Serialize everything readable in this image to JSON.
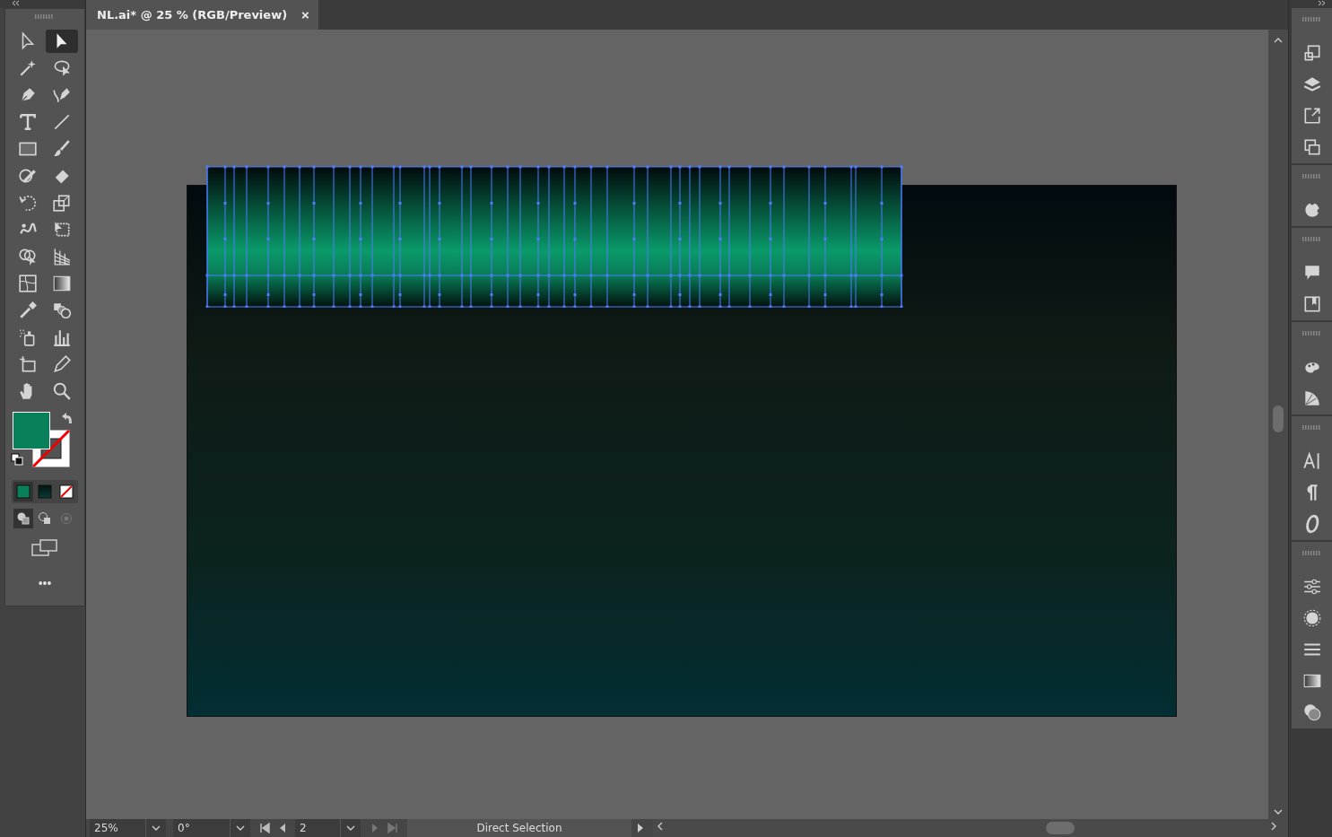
{
  "document_tab": {
    "title": "NL.ai* @ 25 % (RGB/Preview)",
    "close": "×"
  },
  "tools": [
    {
      "kind": "arrow",
      "selected": false
    },
    {
      "kind": "filled-arrow",
      "selected": true
    },
    {
      "kind": "magic-wand",
      "selected": false
    },
    {
      "kind": "lasso",
      "selected": false
    },
    {
      "kind": "pen",
      "selected": false
    },
    {
      "kind": "curvature-pen",
      "selected": false
    },
    {
      "kind": "type",
      "selected": false
    },
    {
      "kind": "line",
      "selected": false
    },
    {
      "kind": "rectangle",
      "selected": false
    },
    {
      "kind": "paintbrush",
      "selected": false
    },
    {
      "kind": "shaper",
      "selected": false
    },
    {
      "kind": "eraser",
      "selected": false
    },
    {
      "kind": "rotate",
      "selected": false
    },
    {
      "kind": "scale",
      "selected": false
    },
    {
      "kind": "warp",
      "selected": false
    },
    {
      "kind": "free-transform",
      "selected": false
    },
    {
      "kind": "shape-builder",
      "selected": false
    },
    {
      "kind": "perspective-grid",
      "selected": false
    },
    {
      "kind": "mesh",
      "selected": false
    },
    {
      "kind": "gradient",
      "selected": false
    },
    {
      "kind": "eyedropper",
      "selected": false
    },
    {
      "kind": "blend",
      "selected": false
    },
    {
      "kind": "symbol-sprayer",
      "selected": false
    },
    {
      "kind": "graph",
      "selected": false
    },
    {
      "kind": "artboard",
      "selected": false
    },
    {
      "kind": "knife",
      "selected": false
    },
    {
      "kind": "hand",
      "selected": false
    },
    {
      "kind": "zoom",
      "selected": false
    }
  ],
  "more_tools": "•••",
  "status_bar": {
    "zoom": "25%",
    "rotation": "0°",
    "artboard": "2",
    "current_tool": "Direct Selection"
  }
}
